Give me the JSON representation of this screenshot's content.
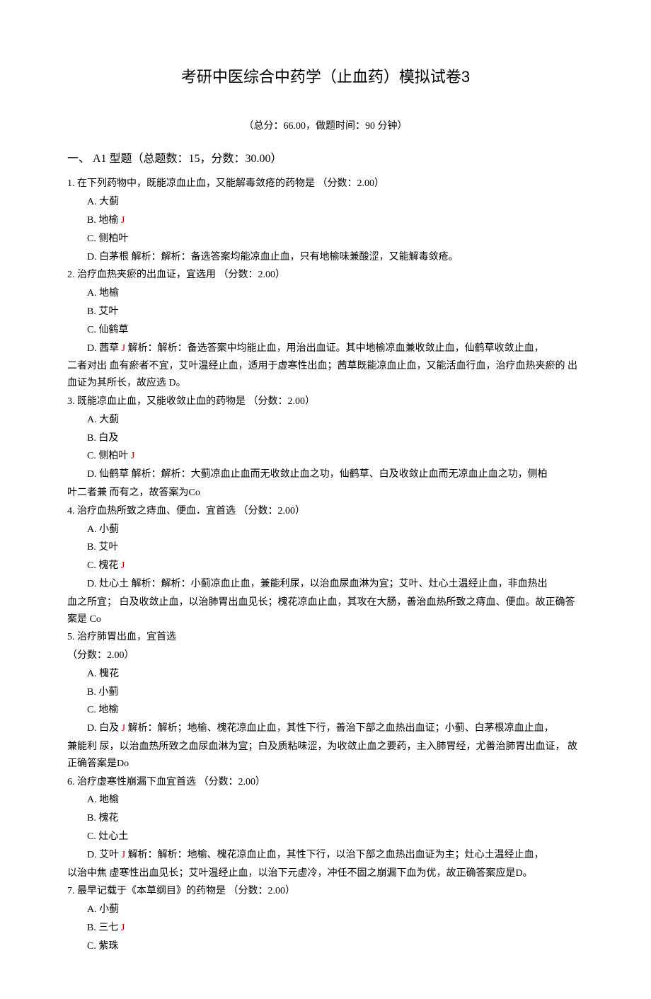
{
  "title": "考研中医综合中药学（止血药）模拟试卷3",
  "score_time": "（总分：66.00，做题时间：90 分钟）",
  "section_header": "一、 A1 型题（总题数：15，分数：30.00）",
  "answer_mark": "J",
  "questions": [
    {
      "num_text": "1.    在下列药物中，既能凉血止血，又能解毒敛疮的药物是 （分数：2.00）",
      "indent": true,
      "options": [
        {
          "label": "A. 大蓟",
          "is_answer": false,
          "explain": ""
        },
        {
          "label": "B. 地榆",
          "is_answer": true,
          "explain": ""
        },
        {
          "label": "C. 侧柏叶",
          "is_answer": false,
          "explain": ""
        },
        {
          "label": "D. 白茅根",
          "is_answer": false,
          "explain": " 解析：解析：备选答案均能凉血止血，只有地榆味兼酸涩，又能解毒敛疮。"
        }
      ]
    },
    {
      "num_text": "2. 治疗血热夹瘀的出血证，宜选用 （分数：2.00）",
      "indent": false,
      "options": [
        {
          "label": "A. 地榆",
          "is_answer": false,
          "explain": ""
        },
        {
          "label": "B. 艾叶",
          "is_answer": false,
          "explain": ""
        },
        {
          "label": "C. 仙鹤草",
          "is_answer": false,
          "explain": ""
        },
        {
          "label": "D. 茜草",
          "is_answer": true,
          "explain": "  解析：解析：备选答案中均能止血，用治出血证。其中地榆凉血兼收敛止血，仙鹤草收敛止血，"
        }
      ],
      "tail": [
        "二者对出 血有瘀者不宜，艾叶温经止血，适用于虚寒性出血；茜草既能凉血止血，又能活血行血，治疗血热夹瘀的 出血证为其所长，故应选 D。"
      ]
    },
    {
      "num_text": "3. 既能凉血止血，又能收敛止血的药物是 （分数：2.00）",
      "indent": false,
      "options": [
        {
          "label": "A. 大蓟",
          "is_answer": false,
          "explain": ""
        },
        {
          "label": "B. 白及",
          "is_answer": false,
          "explain": ""
        },
        {
          "label": "C. 侧柏叶",
          "is_answer": true,
          "explain": ""
        },
        {
          "label": "D. 仙鹤草",
          "is_answer": false,
          "explain": "  解析：解析：大蓟凉血止血而无收敛止血之功，仙鹤草、白及收敛止血而无凉血止血之功，侧柏"
        }
      ],
      "tail": [
        "叶二者兼 而有之，故答案为Co"
      ]
    },
    {
      "num_text": "4. 治疗血热所致之痔血、便血．宜首选 （分数：2.00）",
      "indent": false,
      "options": [
        {
          "label": "A. 小蓟",
          "is_answer": false,
          "explain": ""
        },
        {
          "label": "B. 艾叶",
          "is_answer": false,
          "explain": ""
        },
        {
          "label": "C. 槐花",
          "is_answer": true,
          "explain": ""
        },
        {
          "label": "D. 灶心土",
          "is_answer": false,
          "explain": "  解析：解析：小蓟凉血止血，兼能利尿，以治血尿血淋为宜；艾叶、灶心土温经止血，非血热出"
        }
      ],
      "tail": [
        "血之所宜；  白及收敛止血，以治肺胃出血见长；槐花凉血止血，其攻在大肠，善治血热所致之痔血、便血。故正确答  案是 Co"
      ]
    },
    {
      "num_text": "5. 治疗肺胃出血，宜首选",
      "indent": false,
      "pre_tail": [
        "（分数：2.00）"
      ],
      "options": [
        {
          "label": "A. 槐花",
          "is_answer": false,
          "explain": ""
        },
        {
          "label": "B. 小蓟",
          "is_answer": false,
          "explain": ""
        },
        {
          "label": "C. 地榆",
          "is_answer": false,
          "explain": ""
        },
        {
          "label": "D. 白及",
          "is_answer": true,
          "explain": "  解析：解析；地榆、槐花凉血止血，其性下行，善治下部之血热出血证；小蓟、白茅根凉血止血，"
        }
      ],
      "tail": [
        "兼能利 尿，以治血热所致之血尿血淋为宜；白及质粘味涩，为收敛止血之要药，主入肺胃经，尤善治肺胃出血证， 故正确答案是Do"
      ]
    },
    {
      "num_text": "6. 治疗虚寒性崩漏下血宜首选 （分数：2.00）",
      "indent": false,
      "options": [
        {
          "label": "A. 地榆",
          "is_answer": false,
          "explain": ""
        },
        {
          "label": "B. 槐花",
          "is_answer": false,
          "explain": ""
        },
        {
          "label": "C. 灶心土",
          "is_answer": false,
          "explain": ""
        },
        {
          "label": "D. 艾叶",
          "is_answer": true,
          "explain": "  解析：解析：地榆、槐花凉血止血，其性下行，以治下部之血热出血证为主；灶心土温经止血，"
        }
      ],
      "tail": [
        "以治中焦 虚寒性出血见长；艾叶温经止血，以治下元虚冷，冲任不固之崩漏下血为优，故正确答案应是D。"
      ]
    },
    {
      "num_text": "7. 最早记载于《本草纲目》的药物是 （分数：2.00）",
      "indent": false,
      "options": [
        {
          "label": "A. 小蓟",
          "is_answer": false,
          "explain": ""
        },
        {
          "label": "B. 三七",
          "is_answer": true,
          "explain": ""
        },
        {
          "label": "C. 紫珠",
          "is_answer": false,
          "explain": ""
        }
      ]
    }
  ]
}
